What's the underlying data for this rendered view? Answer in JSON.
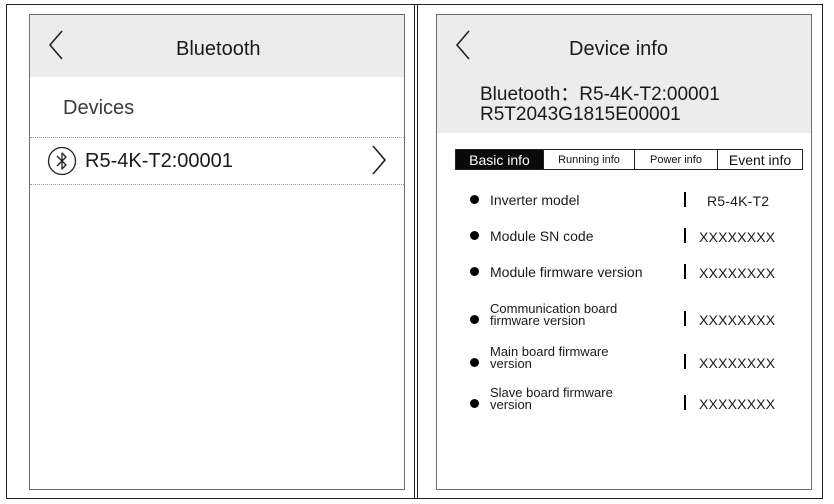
{
  "left_screen": {
    "title": "Bluetooth",
    "section_label": "Devices",
    "device": {
      "name": "R5-4K-T2:00001"
    }
  },
  "right_screen": {
    "title": "Device info",
    "bluetooth_line": "Bluetooth：R5-4K-T2:00001",
    "serial_line": "R5T2043G1815E00001",
    "tabs": [
      {
        "label": "Basic info",
        "active": true
      },
      {
        "label": "Running info",
        "active": false
      },
      {
        "label": "Power info",
        "active": false
      },
      {
        "label": "Event info",
        "active": false
      }
    ],
    "params": [
      {
        "name": "Inverter model",
        "value": "R5-4K-T2"
      },
      {
        "name": "Module SN code",
        "value": "XXXXXXXX"
      },
      {
        "name": "Module firmware version",
        "value": "XXXXXXXX"
      },
      {
        "name_line1": "Communication board",
        "name_line2": "firmware version",
        "value": "XXXXXXXX"
      },
      {
        "name_line1": "Main board firmware",
        "name_line2": "version",
        "value": "XXXXXXXX"
      },
      {
        "name_line1": "Slave board firmware",
        "name_line2": "version",
        "value": "XXXXXXXX"
      }
    ]
  }
}
